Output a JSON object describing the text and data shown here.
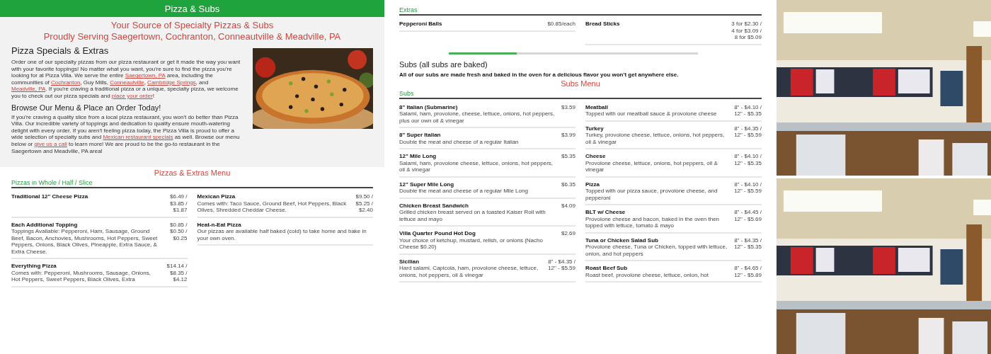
{
  "left_page": {
    "header": "Pizza & Subs",
    "tagline": [
      "Your Source of Specialty Pizzas & Subs",
      "Proudly Serving Saegertown, Cochranton, Conneautville & Meadville, PA"
    ],
    "intro": [
      {
        "kind": "heading",
        "text": "Pizza Specials & Extras"
      },
      {
        "kind": "paragraph",
        "segments": [
          {
            "text": "Order one of our specialty pizzas from our pizza restaurant or get it made the way you want with your favorite toppings! No matter what you want, you're sure to find the pizza you're looking for at Pizza Villa. We serve the entire ",
            "link": false
          },
          {
            "text": "Saegertown, PA",
            "link": true
          },
          {
            "text": " area, including the communities of ",
            "link": false
          },
          {
            "text": "Cochranton",
            "link": true
          },
          {
            "text": ", Guy Mills, ",
            "link": false
          },
          {
            "text": "Conneautville",
            "link": true
          },
          {
            "text": ", ",
            "link": false
          },
          {
            "text": "Cambridge Springs",
            "link": true
          },
          {
            "text": ", and ",
            "link": false
          },
          {
            "text": "Meadville, PA",
            "link": true
          },
          {
            "text": ". If you're craving a traditional pizza or a unique, specialty pizza, we welcome you to check out our pizza specials and ",
            "link": false
          },
          {
            "text": "place your order",
            "link": true
          },
          {
            "text": "!",
            "link": false
          }
        ]
      },
      {
        "kind": "subheading",
        "text": "Browse Our Menu & Place an Order Today!"
      },
      {
        "kind": "paragraph",
        "segments": [
          {
            "text": "If you're craving a quality slice from a local pizza restaurant, you won't do better than Pizza Villa. Our incredible variety of toppings and dedication to quality ensure mouth-watering delight with every order. If you aren't feeling pizza today, the Pizza Villa is proud to offer a wide selection of specialty subs and ",
            "link": false
          },
          {
            "text": "Mexican restaurant specials",
            "link": true
          },
          {
            "text": " as well. Browse our menu below or ",
            "link": false
          },
          {
            "text": "give us a call",
            "link": true
          },
          {
            "text": " to learn more! We are proud to be the go-to restaurant in the Saegertown and Meadville, PA area!",
            "link": false
          }
        ]
      }
    ],
    "hero": {
      "kind": "picture"
    },
    "menu_title": "Pizzas & Extras Menu",
    "section": {
      "title": "Pizzas in Whole / Half / Slice",
      "columns": [
        [
          {
            "name": "Traditional 12\" Cheese Pizza",
            "prices": [
              "$6.49 /",
              "$3.85 /",
              "$1.87"
            ]
          },
          {
            "name": "Each Additional Topping",
            "description": "Toppings Available: Pepperoni, Ham, Sausage, Ground Beef, Bacon, Anchovies, Mushrooms, Hot Peppers, Sweet Peppers, Onions, Black Olives, Pineapple, Extra Sauce, & Extra Cheese.",
            "prices": [
              "$0.85 /",
              "$0.50 /",
              "$0.25"
            ]
          },
          {
            "name": "Everything Pizza",
            "description": "Comes with: Pepperoni, Mushrooms, Sausage, Onions, Hot Peppers, Sweet Peppers, Black Olives, Extra",
            "prices": [
              "$14.14 /",
              "$8.35 /",
              "$4.12"
            ]
          }
        ],
        [
          {
            "name": "Mexican Pizza",
            "description": "Comes with: Taco Sauce, Ground Beef, Hot Peppers, Black Olives, Shredded Cheddar Cheese.",
            "prices": [
              "$9.50 /",
              "$5.25 /",
              "$2.40"
            ]
          },
          {
            "name": "Heat-n-Eat Pizza",
            "description": "Our pizzas are available half baked (cold) to take home and bake in your own oven."
          }
        ]
      ]
    }
  },
  "middle_page": {
    "extras": {
      "title": "Extras",
      "columns": [
        [
          {
            "name": "Pepperoni Balls",
            "prices": [
              "$0.85/each"
            ]
          }
        ],
        [
          {
            "name": "Bread Sticks",
            "prices": [
              "3 for $2.30 /",
              "4 for $3.09 /",
              "8 for $5.09"
            ]
          }
        ]
      ]
    },
    "subs_heading": "Subs (all subs are baked)",
    "subs_note": "All of our subs are made fresh and baked in the oven for a delicious flavor you won't get anywhere else.",
    "menu_title": "Subs Menu",
    "subs": {
      "title": "Subs",
      "columns": [
        [
          {
            "name": "8\" Italian (Submarine)",
            "description": "Salami, ham, provolone, cheese, lettuce, onions, hot peppers, plus our own oil & vinegar",
            "prices": [
              "$3.59"
            ]
          },
          {
            "name": "8\" Super Italian",
            "description": "Double the meat and cheese of a regular Italian",
            "prices": [
              "$3.99"
            ]
          },
          {
            "name": "12\" Mile Long",
            "description": "Salami, ham, provolone cheese, lettuce, onions, hot peppers, oil & vinegar",
            "prices": [
              "$5.35"
            ]
          },
          {
            "name": "12\" Super Mile Long",
            "description": "Double the meat and cheese of a regular Mile Long",
            "prices": [
              "$6.35"
            ]
          },
          {
            "name": "Chicken Breast Sandwich",
            "description": "Grilled chicken breast served on a toasted Kaiser Roll with lettuce and mayo",
            "prices": [
              "$4.09"
            ]
          },
          {
            "name": "Villa Quarter Pound Hot Dog",
            "description": "Your choice of ketchup, mustard, relish, or onions (Nacho Cheese $0.20)",
            "prices": [
              "$2.69"
            ]
          },
          {
            "name": "Sicilian",
            "description": "Hard salami, Capicola, ham, provolone cheese, lettuce, onions, hot peppers, oil & vinegar",
            "prices": [
              "8\" - $4.35 /",
              "12\" - $5.59"
            ]
          }
        ],
        [
          {
            "name": "Meatball",
            "description": "Topped with our meatball sauce & provolone cheese",
            "prices": [
              "8\" - $4.10 /",
              "12\" - $5.35"
            ]
          },
          {
            "name": "Turkey",
            "description": "Turkey, provolone cheese, lettuce, onions, hot peppers, oil & vinegar",
            "prices": [
              "8\" - $4.35 /",
              "12\" - $5.59"
            ]
          },
          {
            "name": "Cheese",
            "description": "Provolone cheese, lettuce, onions, hot peppers, oil & vinegar",
            "prices": [
              "8\" - $4.10 /",
              "12\" - $5.35"
            ]
          },
          {
            "name": "Pizza",
            "description": "Topped with our pizza sauce, provolone cheese, and pepperoni",
            "prices": [
              "8\" - $4.10 /",
              "12\" - $5.59"
            ]
          },
          {
            "name": "BLT w/ Cheese",
            "description": "Provolone cheese and bacon, baked in the oven then topped with lettuce, tomato & mayo",
            "prices": [
              "8\" - $4.45 /",
              "12\" - $5.69"
            ]
          },
          {
            "name": "Tuna or Chicken Salad Sub",
            "description": "Provolone cheese, Tuna or Chicken, topped with lettuce, onion, and hot peppers",
            "prices": [
              "8\" - $4.35 /",
              "12\" - $5.35"
            ]
          },
          {
            "name": "Roast Beef Sub",
            "description": "Roast beef, provolone cheese, lettuce, onion, hot",
            "prices": [
              "8\" - $4.65 /",
              "12\" - $5.89"
            ]
          }
        ]
      ]
    }
  },
  "photos": [
    {
      "kind": "picture"
    },
    {
      "kind": "picture"
    }
  ]
}
